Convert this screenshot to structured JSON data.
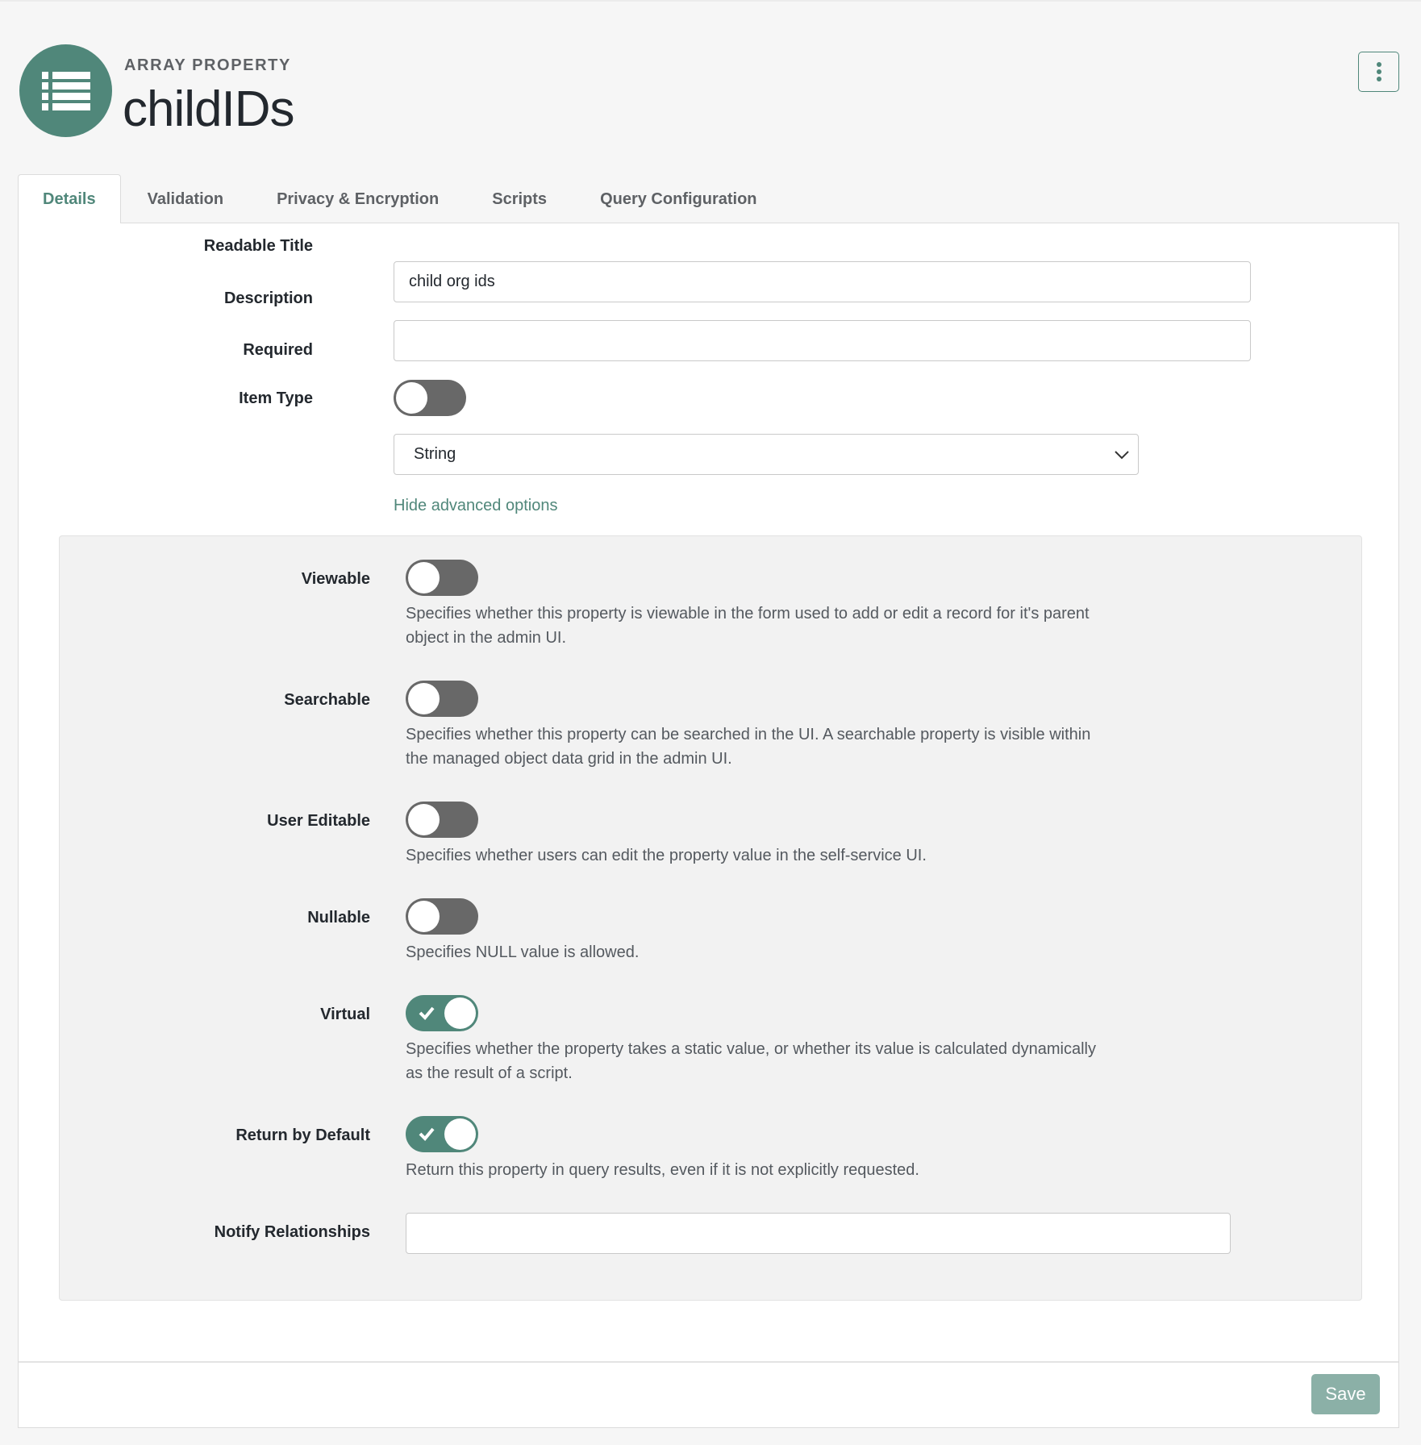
{
  "header": {
    "eyebrow": "ARRAY PROPERTY",
    "title": "childIDs",
    "icon": "list-icon",
    "menu_icon": "kebab-menu-icon"
  },
  "tabs": [
    {
      "label": "Details",
      "active": true
    },
    {
      "label": "Validation",
      "active": false
    },
    {
      "label": "Privacy & Encryption",
      "active": false
    },
    {
      "label": "Scripts",
      "active": false
    },
    {
      "label": "Query Configuration",
      "active": false
    }
  ],
  "form": {
    "readable_title": {
      "label": "Readable Title",
      "value": "child org ids"
    },
    "description": {
      "label": "Description",
      "value": ""
    },
    "required": {
      "label": "Required",
      "on": false
    },
    "item_type": {
      "label": "Item Type",
      "value": "String"
    },
    "advanced_link": "Hide advanced options"
  },
  "advanced": {
    "viewable": {
      "label": "Viewable",
      "on": false,
      "help": "Specifies whether this property is viewable in the form used to add or edit a record for it's parent object in the admin UI."
    },
    "searchable": {
      "label": "Searchable",
      "on": false,
      "help": "Specifies whether this property can be searched in the UI. A searchable property is visible within the managed object data grid in the admin UI."
    },
    "user_editable": {
      "label": "User Editable",
      "on": false,
      "help": "Specifies whether users can edit the property value in the self-service UI."
    },
    "nullable": {
      "label": "Nullable",
      "on": false,
      "help": "Specifies NULL value is allowed."
    },
    "virtual": {
      "label": "Virtual",
      "on": true,
      "help": "Specifies whether the property takes a static value, or whether its value is calculated dynamically as the result of a script."
    },
    "return_by_default": {
      "label": "Return by Default",
      "on": true,
      "help": "Return this property in query results, even if it is not explicitly requested."
    },
    "notify_relationships": {
      "label": "Notify Relationships",
      "value": ""
    }
  },
  "footer": {
    "save_label": "Save"
  },
  "colors": {
    "accent": "#50877a",
    "toggle_off": "#686868",
    "save_disabled": "#8bb0a7"
  }
}
